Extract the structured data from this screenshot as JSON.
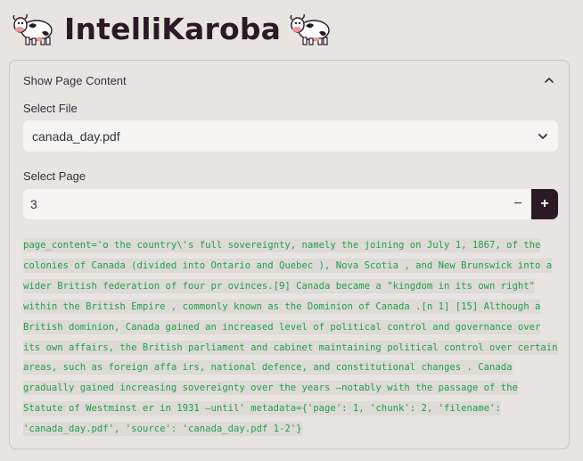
{
  "app": {
    "title": "IntelliKaroba",
    "title_icon": "cow-icon"
  },
  "expander": {
    "label": "Show Page Content",
    "icon": "chevron-up-icon"
  },
  "select_file": {
    "label": "Select File",
    "value": "canada_day.pdf",
    "icon": "chevron-down-icon"
  },
  "select_page": {
    "label": "Select Page",
    "value": "3",
    "minus_label": "−",
    "plus_label": "+"
  },
  "page_content": {
    "text": "page_content='o the country\\'s full sovereignty, namely the joining on July 1, 1867, of the colonies of Canada (divided into Ontario and Quebec ), Nova Scotia , and New Brunswick into a wider British federation of four pr ovinces.[9] Canada became a \"kingdom in its own right\" within the British Empire , commonly known as the Dominion of Canada .[n 1] [15] Although a British dominion, Canada gained an increased level of political control and governance over its own affairs, the British parliament and cabinet maintaining political control over certain areas, such as foreign affa irs, national defence, and constitutional changes . Canada gradually gained increasing sovereignty over the years —notably with the passage of the Statute of Westminst er in 1931 —until' metadata={'page': 1, 'chunk': 2, 'filename': 'canada_day.pdf', 'source': 'canada_day.pdf 1-2'}",
    "color": "#21a04b"
  }
}
